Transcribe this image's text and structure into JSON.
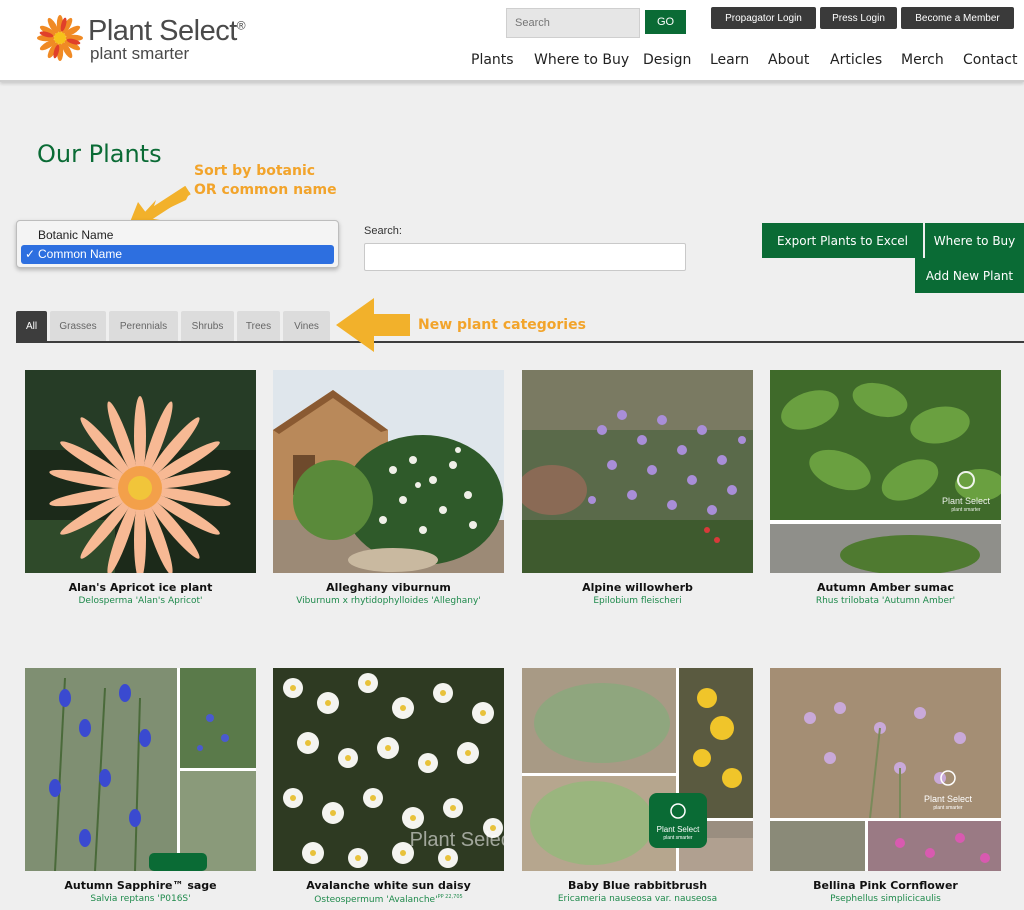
{
  "header": {
    "logo_title": "Plant Select",
    "logo_reg": "®",
    "logo_tagline": "plant smarter",
    "search_placeholder": "Search",
    "go_label": "GO",
    "top_buttons": [
      "Propagator Login",
      "Press Login",
      "Become a Member"
    ],
    "nav": [
      "Plants",
      "Where to Buy",
      "Design",
      "Learn",
      "About",
      "Articles",
      "Merch",
      "Contact"
    ]
  },
  "page": {
    "title": "Our Plants",
    "annotation_sort": [
      "Sort by botanic",
      "OR common name"
    ],
    "annotation_categories": "New plant categories",
    "sort_options": [
      "Botanic Name",
      "Common Name"
    ],
    "sort_selected": "Common Name",
    "check_mark": "✓",
    "search_label": "Search:",
    "search_value": "",
    "buttons": {
      "export": "Export Plants to Excel",
      "where_to_buy": "Where to Buy",
      "add_new": "Add New Plant"
    },
    "tabs": [
      "All",
      "Grasses",
      "Perennials",
      "Shrubs",
      "Trees",
      "Vines"
    ],
    "active_tab": "All"
  },
  "watermark": {
    "title": "Plant Select",
    "tagline": "plant smarter"
  },
  "plants": [
    {
      "common": "Alan's Apricot ice plant",
      "botanic": "Delosperma 'Alan's Apricot'"
    },
    {
      "common": "Alleghany viburnum",
      "botanic": "Viburnum x rhytidophylloides 'Alleghany'"
    },
    {
      "common": "Alpine willowherb",
      "botanic": "Epilobium fleischeri"
    },
    {
      "common": "Autumn Amber sumac",
      "botanic": "Rhus trilobata 'Autumn Amber'"
    },
    {
      "common": "Autumn Sapphire™ sage",
      "botanic": "Salvia reptans 'P016S'"
    },
    {
      "common": "Avalanche white sun daisy",
      "botanic": "Osteospermum 'Avalanche'",
      "botanic_sup": "PP 22,705"
    },
    {
      "common": "Baby Blue rabbitbrush",
      "botanic": "Ericameria nauseosa var. nauseosa"
    },
    {
      "common": "Bellina Pink Cornflower",
      "botanic": "Psephellus simplicicaulis"
    }
  ],
  "colors": {
    "brand_green": "#0a6b35",
    "annotation_orange": "#f2a42b",
    "select_blue": "#2d6fe0",
    "dark_button": "#3a3a3a"
  }
}
